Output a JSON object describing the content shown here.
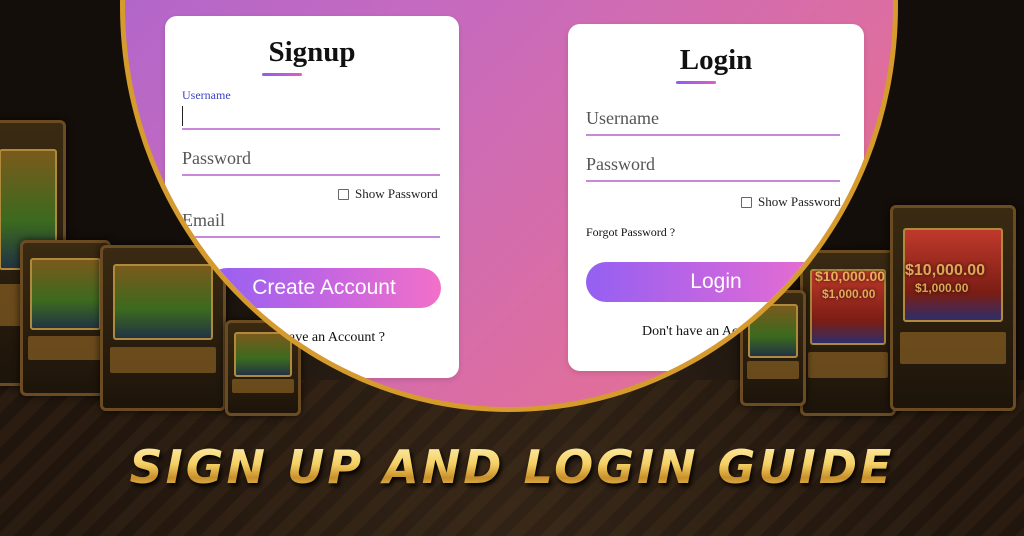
{
  "signup": {
    "heading": "Signup",
    "username_label": "Username",
    "username_value": "",
    "password_placeholder": "Password",
    "show_password": "Show Password",
    "email_placeholder": "Email",
    "create_button": "Create Account",
    "footer_link": "have an Account ?"
  },
  "login": {
    "heading": "Login",
    "username_placeholder": "Username",
    "password_placeholder": "Password",
    "show_password": "Show Password",
    "forgot": "Forgot Password ?",
    "login_button": "Login",
    "footer_link": "Don't have an Acco"
  },
  "jackpots": [
    "$10,000.00",
    "$1,000.00",
    "$10,000.00",
    "$1,000.00"
  ],
  "banner": "SIGN UP AND LOGIN GUIDE",
  "colors": {
    "ring": "#d59b2c",
    "gradient_start": "#9a62d6",
    "gradient_end": "#ea7a93",
    "accent_line": "#c88ad8"
  }
}
